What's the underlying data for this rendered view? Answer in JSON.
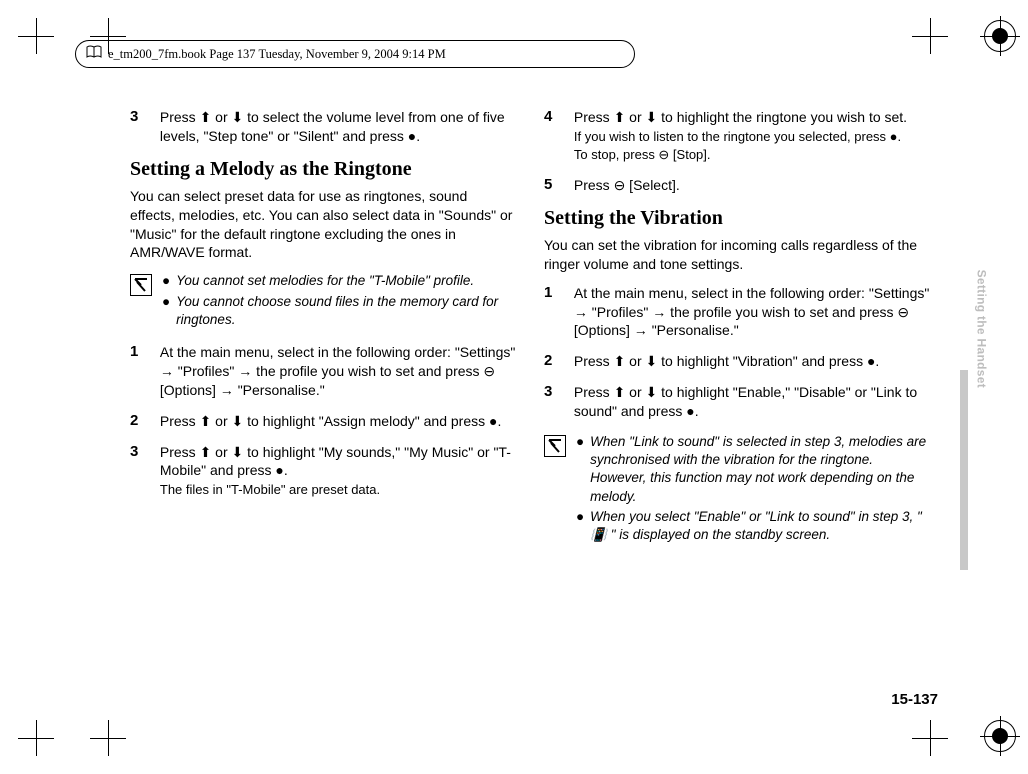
{
  "print_header": "e_tm200_7fm.book  Page 137  Tuesday, November 9, 2004  9:14 PM",
  "section_label": "Setting the Handset",
  "page_num": "15-137",
  "col1": {
    "step3": "Press ⬆ or ⬇ to select the volume level from one of five levels, \"Step tone\" or \"Silent\" and press ●.",
    "h_melody": "Setting a Melody as the Ringtone",
    "intro_melody": "You can select preset data for use as ringtones, sound effects, melodies, etc. You can also select data in \"Sounds\" or \"Music\" for the default ringtone excluding the ones in AMR/WAVE format.",
    "note1_a": "You cannot set melodies for the \"T-Mobile\" profile.",
    "note1_b": "You cannot choose sound files in the memory card for ringtones.",
    "m_step1": "At the main menu, select in the following order: \"Settings\" → \"Profiles\" → the profile you wish to set and press ⊖ [Options] → \"Personalise.\"",
    "m_step2": "Press ⬆ or ⬇ to highlight \"Assign melody\" and press ●.",
    "m_step3": "Press ⬆ or ⬇ to highlight \"My sounds,\" \"My Music\" or \"T-Mobile\" and press ●.",
    "m_step3_sub": "The files in \"T-Mobile\" are preset data."
  },
  "col2": {
    "step4": "Press ⬆ or ⬇ to highlight the ringtone you wish to set.",
    "step4_sub1": "If you wish to listen to the ringtone you selected, press ●.",
    "step4_sub2": "To stop, press ⊖ [Stop].",
    "step5": "Press ⊖ [Select].",
    "h_vib": "Setting the Vibration",
    "intro_vib": "You can set the vibration for incoming calls regardless of the ringer volume and tone settings.",
    "v_step1": "At the main menu, select in the following order: \"Settings\" → \"Profiles\" → the profile you wish to set and press ⊖ [Options] → \"Personalise.\"",
    "v_step2": "Press ⬆ or ⬇ to highlight \"Vibration\" and press ●.",
    "v_step3": "Press ⬆ or ⬇ to highlight \"Enable,\" \"Disable\" or \"Link to sound\" and press ●.",
    "note2_a": "When \"Link to sound\" is selected in step 3, melodies are synchronised with the vibration for the ringtone. However, this function may not work depending on the melody.",
    "note2_b": "When you select \"Enable\" or \"Link to sound\" in step 3, \" 📳 \" is displayed on the standby screen."
  },
  "nums": {
    "n1": "1",
    "n2": "2",
    "n3": "3",
    "n4": "4",
    "n5": "5"
  }
}
